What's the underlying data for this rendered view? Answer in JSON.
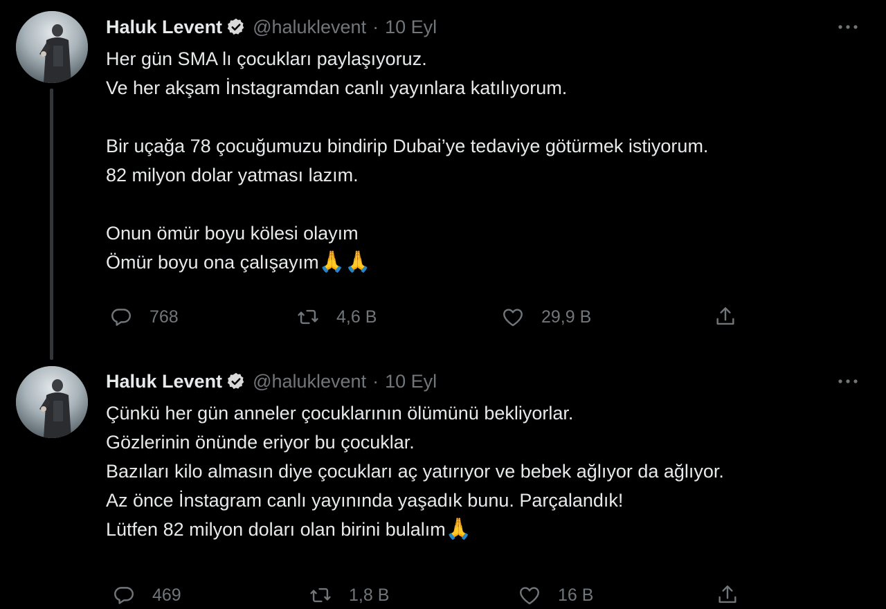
{
  "colors": {
    "background": "#000000",
    "text_primary": "#e7e9ea",
    "text_secondary": "#71767b",
    "thread_line": "#333639"
  },
  "tweets": [
    {
      "author": {
        "name": "Haluk Levent",
        "verified": true,
        "handle": "@haluklevent",
        "separator": "·",
        "date": "10 Eyl"
      },
      "lines": [
        "Her gün SMA lı çocukları paylaşıyoruz.",
        "Ve her akşam İnstagramdan canlı yayınlara katılıyorum.",
        "",
        "Bir uçağa 78 çocuğumuzu bindirip Dubai’ye tedaviye götürmek istiyorum.",
        "82 milyon dolar yatması lazım.",
        "",
        "Onun ömür boyu kölesi olayım",
        "Ömür boyu ona çalışayım"
      ],
      "trailing_emoji": "🙏🙏",
      "stats": {
        "replies": "768",
        "retweets": "4,6 B",
        "likes": "29,9 B"
      },
      "icons": [
        "reply-icon",
        "retweet-icon",
        "like-icon",
        "share-icon",
        "more-icon",
        "verified-badge-icon"
      ]
    },
    {
      "author": {
        "name": "Haluk Levent",
        "verified": true,
        "handle": "@haluklevent",
        "separator": "·",
        "date": "10 Eyl"
      },
      "lines": [
        "Çünkü her gün anneler çocuklarının ölümünü bekliyorlar.",
        "Gözlerinin önünde eriyor bu çocuklar.",
        "Bazıları kilo almasın diye çocukları aç yatırıyor ve bebek ağlıyor da ağlıyor.",
        "Az önce İnstagram canlı yayınında yaşadık bunu. Parçalandık!",
        "Lütfen 82 milyon doları olan birini bulalım"
      ],
      "trailing_emoji": "🙏",
      "stats": {
        "replies": "469",
        "retweets": "1,8 B",
        "likes": "16 B"
      },
      "icons": [
        "reply-icon",
        "retweet-icon",
        "like-icon",
        "share-icon",
        "more-icon",
        "verified-badge-icon"
      ]
    }
  ]
}
